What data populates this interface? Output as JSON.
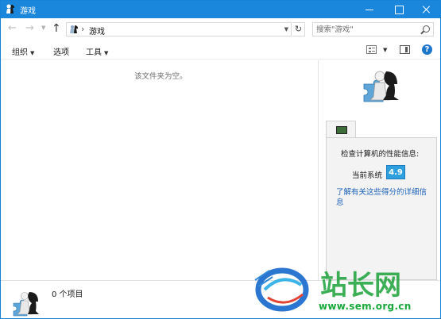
{
  "window": {
    "title": "游戏"
  },
  "address": {
    "path": "游戏",
    "search_placeholder": "搜索\"游戏\""
  },
  "toolbar": {
    "organize": "组织",
    "options": "选项",
    "tools": "工具"
  },
  "content": {
    "empty_message": "该文件夹为空。"
  },
  "details": {
    "perf_heading": "检查计算机的性能信息:",
    "current_label": "当前系统",
    "score": "4.9",
    "link": "了解有关这些得分的详细信息"
  },
  "status": {
    "item_count": "0 个项目"
  },
  "watermark": {
    "brand": "站长网",
    "domain": "www.sem.org.cn"
  },
  "colors": {
    "titlebar": "#1a86dc",
    "score_bg": "#2e9fdf",
    "link": "#1c62b8",
    "watermark_green": "#19a83a"
  }
}
